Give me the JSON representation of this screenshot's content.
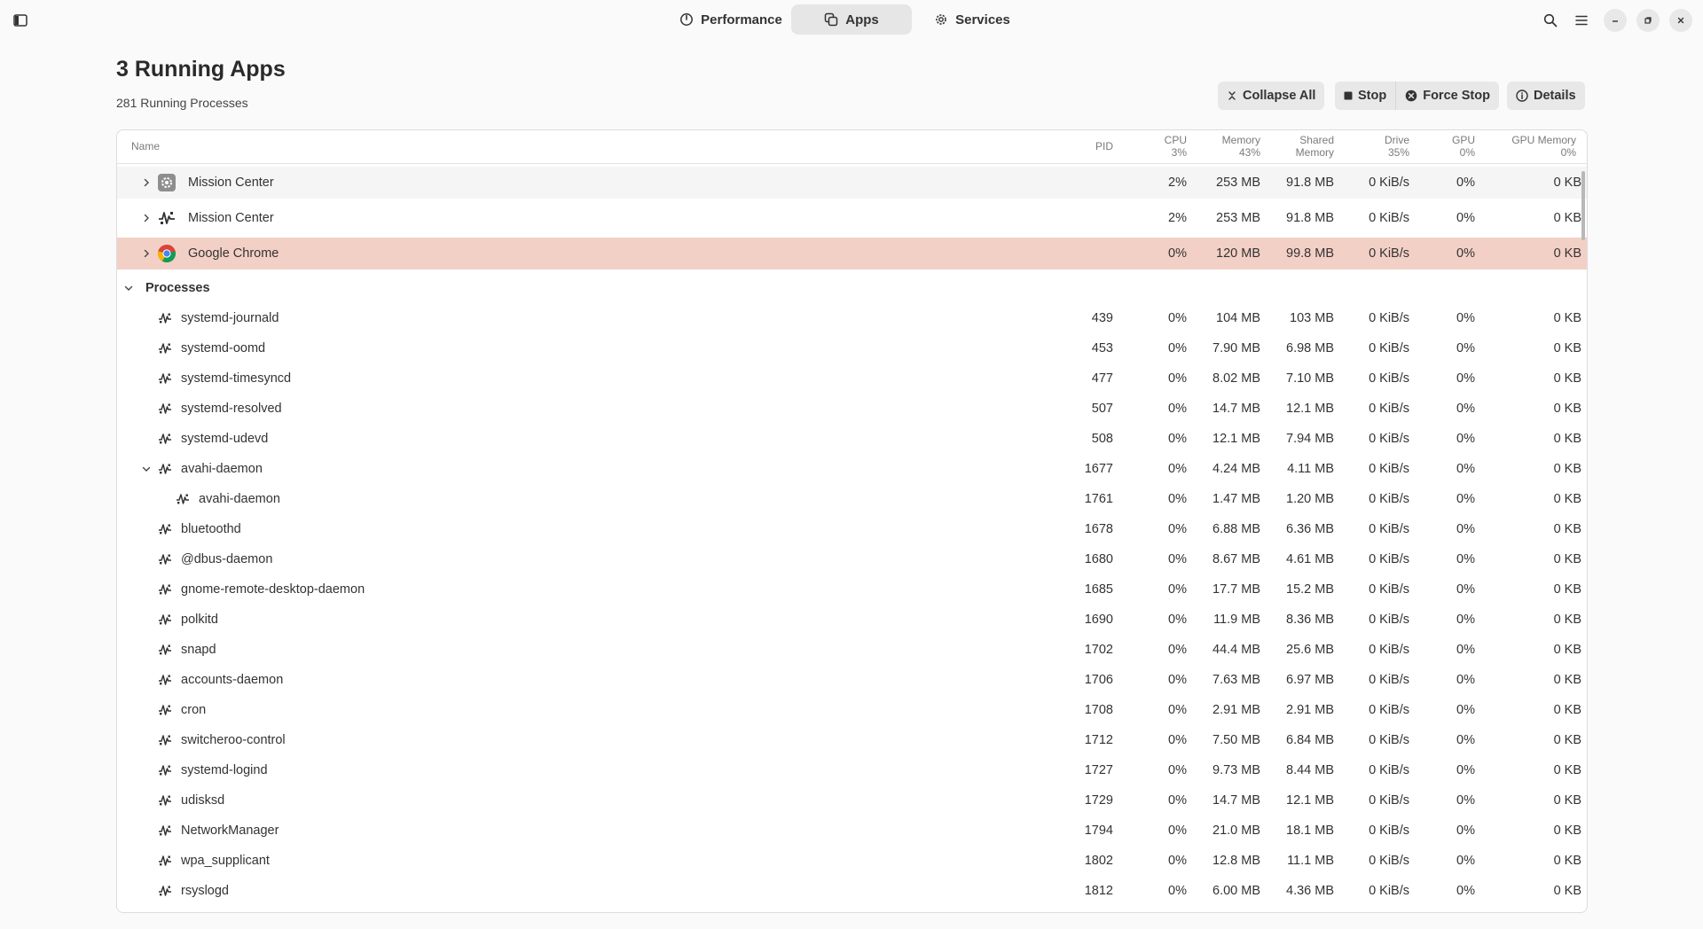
{
  "header": {
    "tabs": [
      {
        "label": "Performance",
        "icon": "performance-gauge-icon"
      },
      {
        "label": "Apps",
        "icon": "apps-icon",
        "active": true
      },
      {
        "label": "Services",
        "icon": "gear-icon"
      }
    ]
  },
  "page": {
    "title": "3 Running Apps",
    "subtitle": "281 Running Processes"
  },
  "actions": {
    "collapse_all": "Collapse All",
    "stop": "Stop",
    "force_stop": "Force Stop",
    "details": "Details"
  },
  "table": {
    "columns": {
      "name": "Name",
      "pid": "PID",
      "cpu": "CPU",
      "cpu_total": "3%",
      "memory": "Memory",
      "memory_total": "43%",
      "shared_memory_1": "Shared",
      "shared_memory_2": "Memory",
      "drive": "Drive",
      "drive_total": "35%",
      "gpu": "GPU",
      "gpu_total": "0%",
      "gpu_memory": "GPU Memory",
      "gpu_memory_total": "0%"
    },
    "apps": [
      {
        "name": "Mission Center",
        "icon": "mission-center-icon",
        "pid": "",
        "cpu": "2%",
        "memory": "253 MB",
        "shared": "91.8 MB",
        "drive": "0 KiB/s",
        "gpu": "0%",
        "gpu_mem": "0 KB"
      },
      {
        "name": "Mission Center",
        "icon": "process-icon",
        "pid": "",
        "cpu": "2%",
        "memory": "253 MB",
        "shared": "91.8 MB",
        "drive": "0 KiB/s",
        "gpu": "0%",
        "gpu_mem": "0 KB"
      },
      {
        "name": "Google Chrome",
        "icon": "chrome-icon",
        "pid": "",
        "cpu": "0%",
        "memory": "120 MB",
        "shared": "99.8 MB",
        "drive": "0 KiB/s",
        "gpu": "0%",
        "gpu_mem": "0 KB",
        "selected": true
      }
    ],
    "processes_label": "Processes",
    "processes": [
      {
        "name": "systemd-journald",
        "pid": "439",
        "cpu": "0%",
        "memory": "104 MB",
        "shared": "103 MB",
        "drive": "0 KiB/s",
        "gpu": "0%",
        "gpu_mem": "0 KB"
      },
      {
        "name": "systemd-oomd",
        "pid": "453",
        "cpu": "0%",
        "memory": "7.90 MB",
        "shared": "6.98 MB",
        "drive": "0 KiB/s",
        "gpu": "0%",
        "gpu_mem": "0 KB"
      },
      {
        "name": "systemd-timesyncd",
        "pid": "477",
        "cpu": "0%",
        "memory": "8.02 MB",
        "shared": "7.10 MB",
        "drive": "0 KiB/s",
        "gpu": "0%",
        "gpu_mem": "0 KB"
      },
      {
        "name": "systemd-resolved",
        "pid": "507",
        "cpu": "0%",
        "memory": "14.7 MB",
        "shared": "12.1 MB",
        "drive": "0 KiB/s",
        "gpu": "0%",
        "gpu_mem": "0 KB"
      },
      {
        "name": "systemd-udevd",
        "pid": "508",
        "cpu": "0%",
        "memory": "12.1 MB",
        "shared": "7.94 MB",
        "drive": "0 KiB/s",
        "gpu": "0%",
        "gpu_mem": "0 KB"
      },
      {
        "name": "avahi-daemon",
        "pid": "1677",
        "cpu": "0%",
        "memory": "4.24 MB",
        "shared": "4.11 MB",
        "drive": "0 KiB/s",
        "gpu": "0%",
        "gpu_mem": "0 KB",
        "expanded": true
      },
      {
        "name": "avahi-daemon",
        "pid": "1761",
        "cpu": "0%",
        "memory": "1.47 MB",
        "shared": "1.20 MB",
        "drive": "0 KiB/s",
        "gpu": "0%",
        "gpu_mem": "0 KB",
        "child": true
      },
      {
        "name": "bluetoothd",
        "pid": "1678",
        "cpu": "0%",
        "memory": "6.88 MB",
        "shared": "6.36 MB",
        "drive": "0 KiB/s",
        "gpu": "0%",
        "gpu_mem": "0 KB"
      },
      {
        "name": "@dbus-daemon",
        "pid": "1680",
        "cpu": "0%",
        "memory": "8.67 MB",
        "shared": "4.61 MB",
        "drive": "0 KiB/s",
        "gpu": "0%",
        "gpu_mem": "0 KB"
      },
      {
        "name": "gnome-remote-desktop-daemon",
        "pid": "1685",
        "cpu": "0%",
        "memory": "17.7 MB",
        "shared": "15.2 MB",
        "drive": "0 KiB/s",
        "gpu": "0%",
        "gpu_mem": "0 KB"
      },
      {
        "name": "polkitd",
        "pid": "1690",
        "cpu": "0%",
        "memory": "11.9 MB",
        "shared": "8.36 MB",
        "drive": "0 KiB/s",
        "gpu": "0%",
        "gpu_mem": "0 KB"
      },
      {
        "name": "snapd",
        "pid": "1702",
        "cpu": "0%",
        "memory": "44.4 MB",
        "shared": "25.6 MB",
        "drive": "0 KiB/s",
        "gpu": "0%",
        "gpu_mem": "0 KB"
      },
      {
        "name": "accounts-daemon",
        "pid": "1706",
        "cpu": "0%",
        "memory": "7.63 MB",
        "shared": "6.97 MB",
        "drive": "0 KiB/s",
        "gpu": "0%",
        "gpu_mem": "0 KB"
      },
      {
        "name": "cron",
        "pid": "1708",
        "cpu": "0%",
        "memory": "2.91 MB",
        "shared": "2.91 MB",
        "drive": "0 KiB/s",
        "gpu": "0%",
        "gpu_mem": "0 KB"
      },
      {
        "name": "switcheroo-control",
        "pid": "1712",
        "cpu": "0%",
        "memory": "7.50 MB",
        "shared": "6.84 MB",
        "drive": "0 KiB/s",
        "gpu": "0%",
        "gpu_mem": "0 KB"
      },
      {
        "name": "systemd-logind",
        "pid": "1727",
        "cpu": "0%",
        "memory": "9.73 MB",
        "shared": "8.44 MB",
        "drive": "0 KiB/s",
        "gpu": "0%",
        "gpu_mem": "0 KB"
      },
      {
        "name": "udisksd",
        "pid": "1729",
        "cpu": "0%",
        "memory": "14.7 MB",
        "shared": "12.1 MB",
        "drive": "0 KiB/s",
        "gpu": "0%",
        "gpu_mem": "0 KB"
      },
      {
        "name": "NetworkManager",
        "pid": "1794",
        "cpu": "0%",
        "memory": "21.0 MB",
        "shared": "18.1 MB",
        "drive": "0 KiB/s",
        "gpu": "0%",
        "gpu_mem": "0 KB"
      },
      {
        "name": "wpa_supplicant",
        "pid": "1802",
        "cpu": "0%",
        "memory": "12.8 MB",
        "shared": "11.1 MB",
        "drive": "0 KiB/s",
        "gpu": "0%",
        "gpu_mem": "0 KB"
      },
      {
        "name": "rsyslogd",
        "pid": "1812",
        "cpu": "0%",
        "memory": "6.00 MB",
        "shared": "4.36 MB",
        "drive": "0 KiB/s",
        "gpu": "0%",
        "gpu_mem": "0 KB"
      }
    ]
  }
}
